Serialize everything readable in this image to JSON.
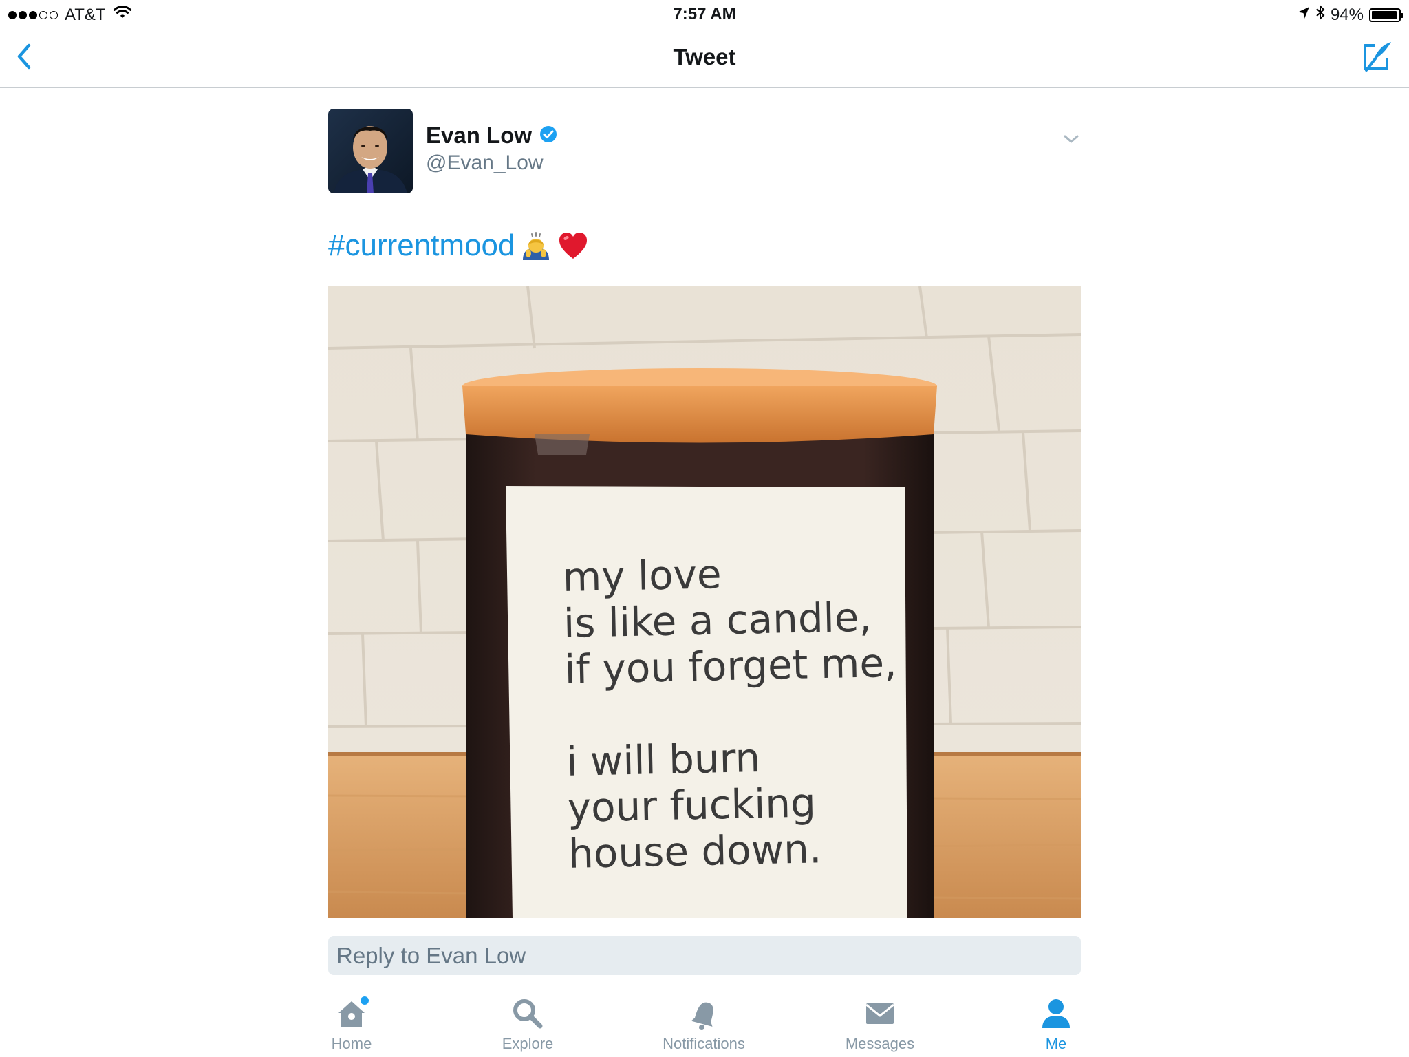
{
  "status_bar": {
    "carrier": "AT&T",
    "time": "7:57 AM",
    "battery": "94%",
    "battery_level": 0.94,
    "signal_bars_filled": 3,
    "signal_bars_total": 5
  },
  "nav": {
    "title": "Tweet",
    "back_icon": "chevron-left-icon",
    "compose_icon": "compose-tweet-icon"
  },
  "tweet": {
    "author_name": "Evan Low",
    "verified": true,
    "handle": "@Evan_Low",
    "hashtag": "#currentmood",
    "emojis": [
      "person-bowing-emoji",
      "red-heart-emoji"
    ],
    "image_text": "my love\nis like a candle,\nif you forget me,\n\ni will burn\nyour fucking\nhouse down."
  },
  "reply": {
    "placeholder": "Reply to Evan Low"
  },
  "tabs": [
    {
      "label": "Home",
      "icon": "home-icon",
      "active": false,
      "has_badge": true
    },
    {
      "label": "Explore",
      "icon": "search-icon",
      "active": false
    },
    {
      "label": "Notifications",
      "icon": "bell-icon",
      "active": false
    },
    {
      "label": "Messages",
      "icon": "envelope-icon",
      "active": false
    },
    {
      "label": "Me",
      "icon": "person-icon",
      "active": true
    }
  ],
  "colors": {
    "accent": "#1b95e0",
    "text_primary": "#14171a",
    "text_secondary": "#657786",
    "tab_inactive": "#8899a6",
    "reply_bg": "#e6ecf0"
  }
}
